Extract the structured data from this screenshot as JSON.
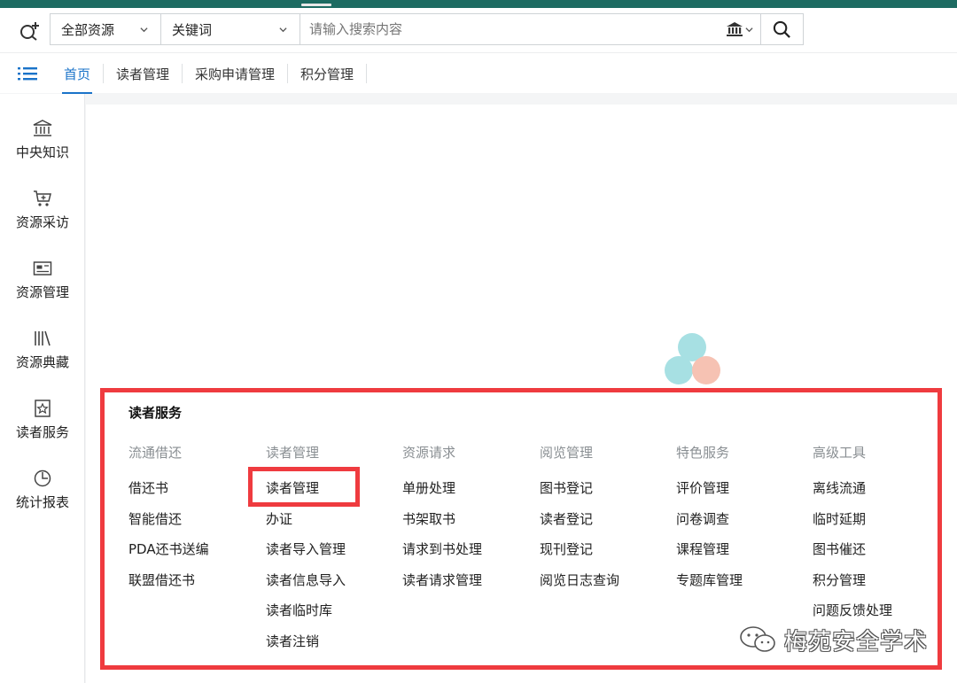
{
  "search": {
    "scope_select": "全部资源",
    "field_select": "关键词",
    "placeholder": "请输入搜索内容"
  },
  "nav": {
    "tabs": [
      {
        "label": "首页",
        "active": true
      },
      {
        "label": "读者管理",
        "active": false
      },
      {
        "label": "采购申请管理",
        "active": false
      },
      {
        "label": "积分管理",
        "active": false
      }
    ]
  },
  "sidebar": {
    "items": [
      {
        "label": "中央知识",
        "icon": "bank-icon"
      },
      {
        "label": "资源采访",
        "icon": "cart-add-icon"
      },
      {
        "label": "资源管理",
        "icon": "card-icon"
      },
      {
        "label": "资源典藏",
        "icon": "books-icon"
      },
      {
        "label": "读者服务",
        "icon": "star-badge-icon"
      },
      {
        "label": "统计报表",
        "icon": "pie-clock-icon"
      }
    ]
  },
  "panel": {
    "title": "读者服务",
    "columns": [
      {
        "heading": "流通借还",
        "items": [
          "借还书",
          "智能借还",
          "PDA还书送编",
          "联盟借还书"
        ]
      },
      {
        "heading": "读者管理",
        "items": [
          "读者管理",
          "办证",
          "读者导入管理",
          "读者信息导入",
          "读者临时库",
          "读者注销"
        ]
      },
      {
        "heading": "资源请求",
        "items": [
          "单册处理",
          "书架取书",
          "请求到书处理",
          "读者请求管理"
        ]
      },
      {
        "heading": "阅览管理",
        "items": [
          "图书登记",
          "读者登记",
          "现刊登记",
          "阅览日志查询"
        ]
      },
      {
        "heading": "特色服务",
        "items": [
          "评价管理",
          "问卷调查",
          "课程管理",
          "专题库管理"
        ]
      },
      {
        "heading": "高级工具",
        "items": [
          "离线流通",
          "临时延期",
          "图书催还",
          "积分管理",
          "问题反馈处理"
        ]
      }
    ]
  },
  "watermark": {
    "text": "梅苑安全学术"
  },
  "colors": {
    "topbar": "#1d6b62",
    "accent_blue": "#1a73c9",
    "highlight_red": "#ef3b3f",
    "blob_teal": "#a7e0e3",
    "blob_peach": "#f6c2b3"
  }
}
